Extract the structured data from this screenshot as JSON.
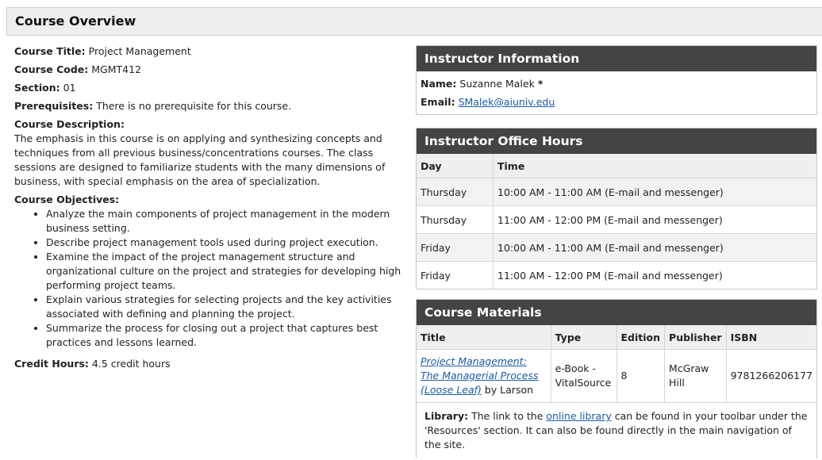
{
  "header": {
    "title": "Course Overview"
  },
  "course": {
    "title_label": "Course Title:",
    "title": "Project Management",
    "code_label": "Course Code:",
    "code": "MGMT412",
    "section_label": "Section:",
    "section": "01",
    "prereq_label": "Prerequisites:",
    "prereq": "There is no prerequisite for this course.",
    "desc_label": "Course Description:",
    "description": "The emphasis in this course is on applying and synthesizing concepts and techniques from all previous business/concentrations courses. The class sessions are designed to familiarize students with the many dimensions of business, with special emphasis on the area of specialization.",
    "objectives_label": "Course Objectives:",
    "objectives": [
      "Analyze the main components of project management in the modern business setting.",
      "Describe project management tools used during project execution.",
      "Examine the impact of the project management structure and organizational culture on the project and strategies for developing high performing project teams.",
      "Explain various strategies for selecting projects and the key activities associated with defining and planning the project.",
      "Summarize the process for closing out a project that captures best practices and lessons learned."
    ],
    "credit_label": "Credit Hours:",
    "credit": "4.5 credit hours"
  },
  "instructor": {
    "heading": "Instructor Information",
    "name_label": "Name:",
    "name": "Suzanne Malek",
    "name_mark": "*",
    "email_label": "Email:",
    "email": "SMalek@aiuniv.edu"
  },
  "office_hours": {
    "heading": "Instructor Office Hours",
    "col_day": "Day",
    "col_time": "Time",
    "rows": [
      {
        "day": "Thursday",
        "time": "10:00 AM - 11:00 AM (E-mail and messenger)"
      },
      {
        "day": "Thursday",
        "time": "11:00 AM - 12:00 PM (E-mail and messenger)"
      },
      {
        "day": "Friday",
        "time": "10:00 AM - 11:00 AM (E-mail and messenger)"
      },
      {
        "day": "Friday",
        "time": "11:00 AM - 12:00 PM (E-mail and messenger)"
      }
    ]
  },
  "materials": {
    "heading": "Course Materials",
    "col_title": "Title",
    "col_type": "Type",
    "col_edition": "Edition",
    "col_publisher": "Publisher",
    "col_isbn": "ISBN",
    "book_title": "Project Management: The Managerial Process (Loose Leaf)",
    "book_author": " by Larson",
    "type": "e-Book - VitalSource",
    "edition": "8",
    "publisher": "McGraw Hill",
    "isbn": "9781266206177",
    "library_label": "Library:",
    "library_text_1": " The link to the ",
    "library_link": "online library",
    "library_text_2": " can be found in your toolbar under the 'Resources' section. It can also be found directly in the main navigation of the site."
  },
  "colors": {
    "panel_header": "#444444",
    "link": "#1b5aa8",
    "header_bg": "#eeeeee"
  }
}
